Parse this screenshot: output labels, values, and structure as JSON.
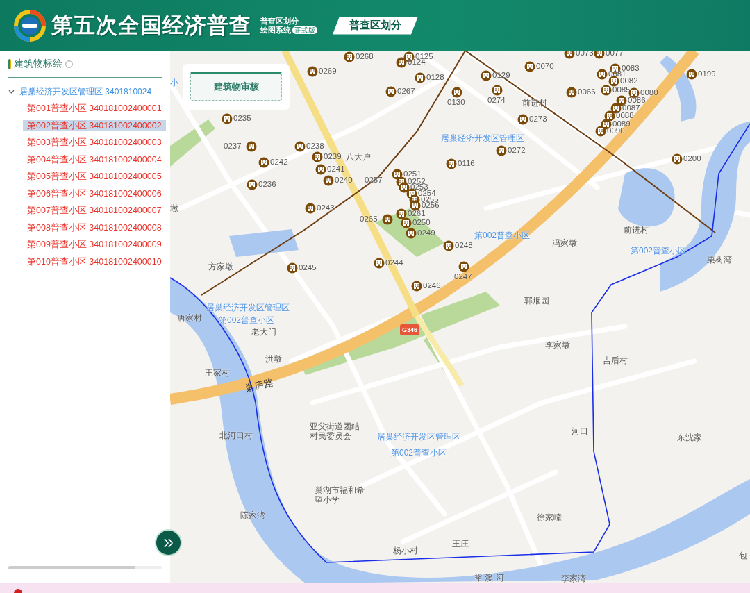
{
  "header": {
    "title": "第五次全国经济普查",
    "subtitle_lines": [
      "普查区划分",
      "绘图系统"
    ],
    "badge": "正式版",
    "tabs": [
      {
        "label": "普查区划分",
        "selected": true
      }
    ]
  },
  "sidebar": {
    "title": "建筑物标绘",
    "tree": [
      {
        "label": "居巢经济开发区管理区 3401810024",
        "expanded": true,
        "children": [
          {
            "label": "第001普查小区 340181002400001",
            "selected": false
          },
          {
            "label": "第002普查小区 340181002400002",
            "selected": true
          },
          {
            "label": "第003普查小区 340181002400003",
            "selected": false
          },
          {
            "label": "第004普查小区 340181002400004",
            "selected": false
          },
          {
            "label": "第005普查小区 340181002400005",
            "selected": false
          },
          {
            "label": "第006普查小区 340181002400006",
            "selected": false
          },
          {
            "label": "第007普查小区 340181002400007",
            "selected": false
          },
          {
            "label": "第008普查小区 340181002400008",
            "selected": false
          },
          {
            "label": "第009普查小区 340181002400009",
            "selected": false
          },
          {
            "label": "第010普查小区 340181002400010",
            "selected": false
          }
        ]
      }
    ]
  },
  "map": {
    "review_button": "建筑物审核",
    "markers": [
      "0268",
      "0125",
      "0124",
      "0128",
      "0269",
      "0267",
      "0130",
      "0235",
      "0237",
      "0238",
      "0239",
      "0241",
      "0240",
      "0242",
      "0236",
      "0243",
      "0251",
      "0252",
      "0253",
      "0254",
      "0255",
      "0256",
      "0261",
      "0250",
      "0249",
      "0265",
      "0116",
      "0248",
      "0244",
      "0247",
      "0245",
      "0246",
      "0272",
      "0273",
      "0274",
      "0129",
      "0199",
      "0200",
      "0066",
      "0073",
      "0077",
      "0083",
      "0081",
      "0082",
      "0085",
      "0080",
      "0086",
      "0087",
      "0088",
      "0089",
      "0090",
      "0070"
    ],
    "orphan_labels": [
      "0257"
    ],
    "region_labels": [
      "小",
      "居巢经济开发区管理区",
      "第002普查小区",
      "第002普查小区",
      "居巢经济开发区管理区",
      "第002普查小区",
      "居巢经济开发区管理区",
      "第002普查小区"
    ],
    "place_labels": [
      "八大户",
      "前进村",
      "前进村",
      "冯家墩",
      "郭烟园",
      "李家墩",
      "吉后村",
      "洪墩",
      "王家村",
      "唐家村",
      "方家墩",
      "北河口村",
      "亚父街道团结村民委员会",
      "巢湖市福和希望小学",
      "陈家湾",
      "徐家疃",
      "杨小村",
      "王庄",
      "河口",
      "东沈家",
      "李家湾",
      "栗树湾",
      "墩",
      "老大门",
      "包",
      "裕 溪 河"
    ],
    "road_label": "巢庐路",
    "road_shield": "G346"
  }
}
